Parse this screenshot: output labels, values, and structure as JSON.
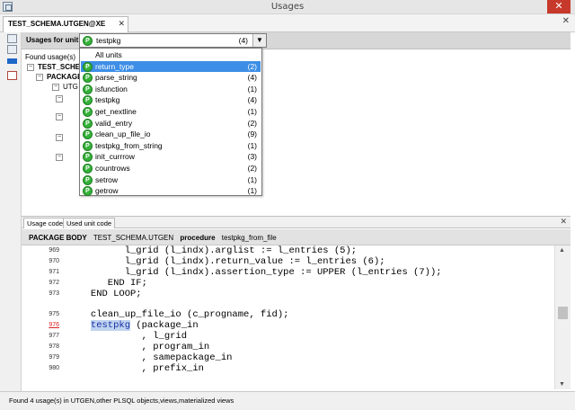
{
  "window": {
    "title": "Usages",
    "close_glyph": "✕"
  },
  "doc_tab": {
    "label": "TEST_SCHEMA.UTGEN@XE",
    "close_glyph": "✕"
  },
  "doc_close_glyph": "✕",
  "filter": {
    "label": "Usages for unit :",
    "selected_value": "testpkg",
    "selected_count": "(4)",
    "drop_glyph": "▼"
  },
  "tree": {
    "found_label": "Found usage(s)",
    "nodes": [
      {
        "label": "TEST_SCHEM"
      },
      {
        "label": "PACKAGE"
      },
      {
        "label": "UTG"
      }
    ]
  },
  "dropdown": {
    "all_label": "All units",
    "icon_letter": "P",
    "items": [
      {
        "name": "return_type",
        "count": "(2)",
        "selected": true
      },
      {
        "name": "parse_string",
        "count": "(4)"
      },
      {
        "name": "isfunction",
        "count": "(1)"
      },
      {
        "name": "testpkg",
        "count": "(4)"
      },
      {
        "name": "get_nextline",
        "count": "(1)"
      },
      {
        "name": "valid_entry",
        "count": "(2)"
      },
      {
        "name": "clean_up_file_io",
        "count": "(9)"
      },
      {
        "name": "testpkg_from_string",
        "count": "(1)"
      },
      {
        "name": "init_currrow",
        "count": "(3)"
      },
      {
        "name": "countrows",
        "count": "(2)"
      },
      {
        "name": "setrow",
        "count": "(1)"
      },
      {
        "name": "getrow",
        "count": "(1)"
      }
    ]
  },
  "bottom_tabs": [
    "Usage code",
    "Used unit code"
  ],
  "pane_close_glyph": "✕",
  "path": {
    "kind": "PACKAGE BODY",
    "owner": "TEST_SCHEMA.UTGEN",
    "sub_kind": "procedure",
    "name": "testpkg_from_file"
  },
  "code": [
    {
      "ln": "969",
      "text": "         l_grid (l_indx).arglist := l_entries (5);"
    },
    {
      "ln": "970",
      "text": "         l_grid (l_indx).return_value := l_entries (6);"
    },
    {
      "ln": "971",
      "text": "         l_grid (l_indx).assertion_type := UPPER (l_entries (7));"
    },
    {
      "ln": "972",
      "text": "      END IF;"
    },
    {
      "ln": "973",
      "text": "   END LOOP;"
    },
    {
      "ln": "975",
      "text": "   clean_up_file_io (c_progname, fid);"
    },
    {
      "ln": "976",
      "text_pre": "   ",
      "text_hl": "testpkg",
      "text_post": " (package_in",
      "red": true
    },
    {
      "ln": "977",
      "text": "            , l_grid"
    },
    {
      "ln": "978",
      "text": "            , program_in"
    },
    {
      "ln": "979",
      "text": "            , samepackage_in"
    },
    {
      "ln": "980",
      "text": "            , prefix_in"
    }
  ],
  "status": "Found 4 usage(s) in UTGEN,other PLSQL objects,views,materialized views",
  "colors": {
    "selected_bg": "#3d8ee6",
    "package_icon": "#36b13a",
    "identifier": "#1a2fa8",
    "error_line": "#e02020"
  }
}
